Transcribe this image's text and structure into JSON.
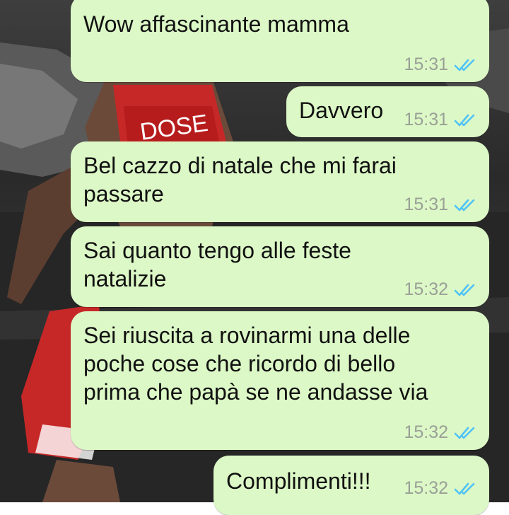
{
  "chat": {
    "messages": [
      {
        "text": "Wow affascinante mamma",
        "time": "15:31",
        "status": "read"
      },
      {
        "text": "Davvero",
        "time": "15:31",
        "status": "read"
      },
      {
        "text": "Bel cazzo di natale che mi farai\npassare",
        "time": "15:31",
        "status": "read"
      },
      {
        "text": "Sai quanto tengo alle feste\nnatalizie",
        "time": "15:32",
        "status": "read"
      },
      {
        "text": "Sei riuscita a rovinarmi una delle\npoche cose che ricordo di bello\nprima che papà se ne andasse via",
        "time": "15:32",
        "status": "read"
      },
      {
        "text": "Complimenti!!!",
        "time": "15:32",
        "status": "read"
      }
    ]
  },
  "colors": {
    "bubble": "#dcf8c6",
    "read_ticks": "#4fc3f7",
    "timestamp": "#9aa097"
  },
  "icons": {
    "wallpaper": "basketball-player-wallpaper",
    "status": "double-check-icon"
  }
}
